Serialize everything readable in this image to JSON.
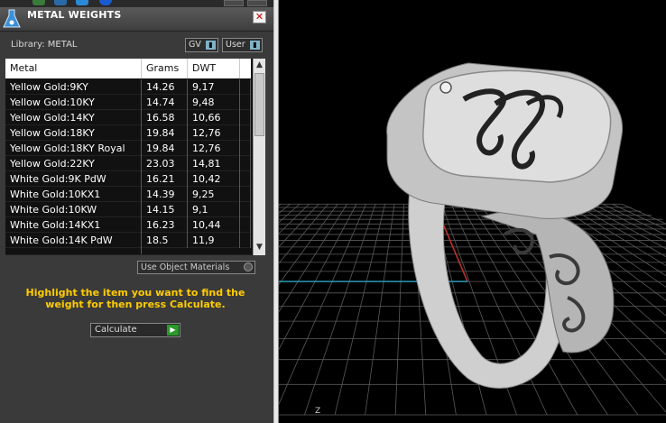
{
  "window": {
    "title": "METAL WEIGHTS",
    "close_glyph": "✕"
  },
  "library": {
    "label": "Library: METAL",
    "gv_toggle": "GV",
    "user_toggle": "User"
  },
  "table": {
    "columns": [
      "Metal",
      "Grams",
      "DWT"
    ],
    "rows": [
      {
        "metal": "Yellow Gold:9KY",
        "grams": "14.26",
        "dwt": "9,17"
      },
      {
        "metal": "Yellow Gold:10KY",
        "grams": "14.74",
        "dwt": "9,48"
      },
      {
        "metal": "Yellow Gold:14KY",
        "grams": "16.58",
        "dwt": "10,66"
      },
      {
        "metal": "Yellow Gold:18KY",
        "grams": "19.84",
        "dwt": "12,76"
      },
      {
        "metal": "Yellow Gold:18KY Royal",
        "grams": "19.84",
        "dwt": "12,76"
      },
      {
        "metal": "Yellow Gold:22KY",
        "grams": "23.03",
        "dwt": "14,81"
      },
      {
        "metal": "White Gold:9K PdW",
        "grams": "16.21",
        "dwt": "10,42"
      },
      {
        "metal": "White Gold:10KX1",
        "grams": "14.39",
        "dwt": "9,25"
      },
      {
        "metal": "White Gold:10KW",
        "grams": "14.15",
        "dwt": "9,1"
      },
      {
        "metal": "White Gold:14KX1",
        "grams": "16.23",
        "dwt": "10,44"
      },
      {
        "metal": "White Gold:14K PdW",
        "grams": "18.5",
        "dwt": "11,9"
      }
    ]
  },
  "use_object_materials": "Use Object Materials",
  "hint": "Highlight the item you want to find the weight for then press Calculate.",
  "calculate": "Calculate",
  "viewport": {
    "background": "#000000",
    "grid_color": "#5a5a5a",
    "axis_x_color": "#c83232",
    "axis_y_color": "#2a9ab8",
    "axis_label": "Z"
  }
}
